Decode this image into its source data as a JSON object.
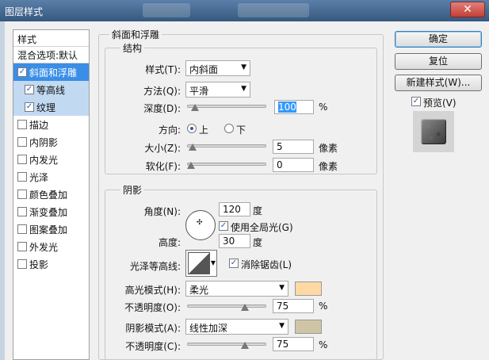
{
  "window": {
    "title": "图层样式",
    "close_glyph": "✕"
  },
  "styles_panel": {
    "header": "样式",
    "blend_options": "混合选项:默认",
    "items": [
      {
        "label": "斜面和浮雕",
        "checked": true
      },
      {
        "label": "等高线",
        "checked": true
      },
      {
        "label": "纹理",
        "checked": true
      },
      {
        "label": "描边",
        "checked": false
      },
      {
        "label": "内阴影",
        "checked": false
      },
      {
        "label": "内发光",
        "checked": false
      },
      {
        "label": "光泽",
        "checked": false
      },
      {
        "label": "颜色叠加",
        "checked": false
      },
      {
        "label": "渐变叠加",
        "checked": false
      },
      {
        "label": "图案叠加",
        "checked": false
      },
      {
        "label": "外发光",
        "checked": false
      },
      {
        "label": "投影",
        "checked": false
      }
    ]
  },
  "bevel": {
    "group_title": "斜面和浮雕",
    "structure": {
      "title": "结构",
      "style_label": "样式(T):",
      "style_value": "内斜面",
      "technique_label": "方法(Q):",
      "technique_value": "平滑",
      "depth_label": "深度(D):",
      "depth_value": "100",
      "depth_unit": "%",
      "depth_level": 0.05,
      "direction_label": "方向:",
      "direction_up": "上",
      "direction_down": "下",
      "direction_selected": "上",
      "size_label": "大小(Z):",
      "size_value": "5",
      "size_unit": "像素",
      "size_level": 0.02,
      "soften_label": "软化(F):",
      "soften_value": "0",
      "soften_unit": "像素",
      "soften_level": 0.0
    },
    "shading": {
      "title": "阴影",
      "angle_label": "角度(N):",
      "angle_value": "120",
      "angle_unit": "度",
      "global_light_label": "使用全局光(G)",
      "global_light_checked": true,
      "altitude_label": "高度:",
      "altitude_value": "30",
      "altitude_unit": "度",
      "gloss_contour_label": "光泽等高线:",
      "antialias_label": "消除锯齿(L)",
      "antialias_checked": true,
      "highlight_mode_label": "高光模式(H):",
      "highlight_mode_value": "柔光",
      "highlight_color": "#ffd9a3",
      "highlight_opacity_label": "不透明度(O):",
      "highlight_opacity_value": "75",
      "highlight_opacity_unit": "%",
      "highlight_opacity_level": 0.75,
      "shadow_mode_label": "阴影模式(A):",
      "shadow_mode_value": "线性加深",
      "shadow_color": "#cfc5a6",
      "shadow_opacity_label": "不透明度(C):",
      "shadow_opacity_value": "75",
      "shadow_opacity_unit": "%",
      "shadow_opacity_level": 0.75
    }
  },
  "actions": {
    "ok": "确定",
    "reset": "复位",
    "new_style": "新建样式(W)...",
    "preview_label": "预览(V)",
    "preview_checked": true
  },
  "icons": {
    "checkbox_on": "✓",
    "dropdown": "▼",
    "crosshair": "✣"
  }
}
